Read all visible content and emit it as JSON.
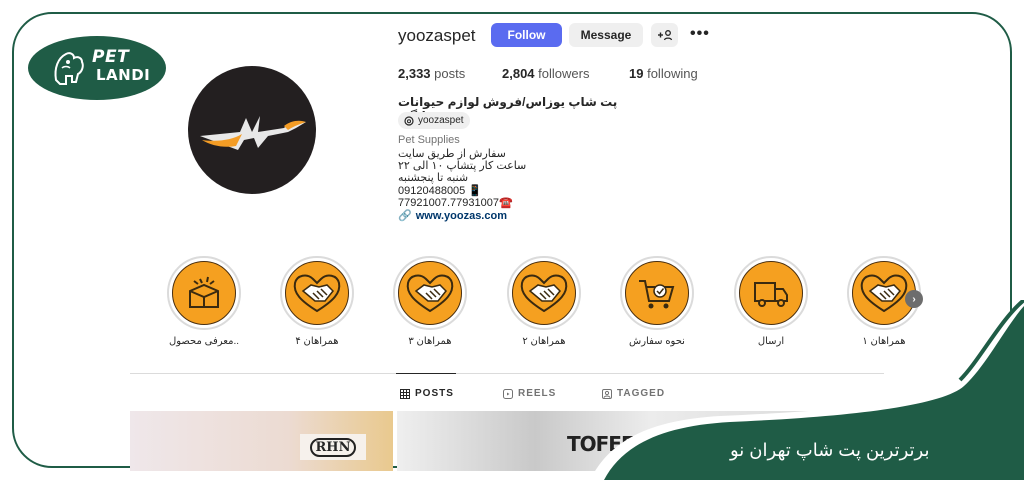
{
  "brand": {
    "logo_line1": "PET",
    "logo_line2": "LANDI"
  },
  "profile": {
    "username": "yoozaspet",
    "follow_label": "Follow",
    "message_label": "Message",
    "add_user_glyph": "+⧉",
    "more_glyph": "•••",
    "stats": {
      "posts_count": "2,333",
      "posts_label": "posts",
      "followers_count": "2,804",
      "followers_label": "followers",
      "following_count": "19",
      "following_label": "following"
    },
    "bio": {
      "name": "پت شاپ یوزاس/فروش لوازم حیوانات خانگی",
      "threads_handle": "yoozaspet",
      "category": "Pet Supplies",
      "lines": [
        "سفارش از طریق سایت",
        "ساعت کار پتشاپ ۱۰ الی ۲۲",
        "شنبه تا پنجشنبه",
        "09120488005 📱",
        "77921007.77931007☎️"
      ],
      "link": "www.yoozas.com"
    }
  },
  "highlights": [
    {
      "label": "معرفی محصول..",
      "icon": "gift-box-icon"
    },
    {
      "label": "همراهان ۴",
      "icon": "handshake-icon"
    },
    {
      "label": "همراهان ۳",
      "icon": "handshake-icon"
    },
    {
      "label": "همراهان ۲",
      "icon": "handshake-icon"
    },
    {
      "label": "نحوه سفارش",
      "icon": "shopping-cart-icon"
    },
    {
      "label": "ارسال",
      "icon": "delivery-truck-icon"
    },
    {
      "label": "همراهان ۱",
      "icon": "handshake-icon"
    }
  ],
  "tabs": [
    {
      "label": "POSTS",
      "icon": "grid-icon",
      "active": true
    },
    {
      "label": "REELS",
      "icon": "reels-icon",
      "active": false
    },
    {
      "label": "TAGGED",
      "icon": "tagged-icon",
      "active": false
    }
  ],
  "posts": {
    "tile1_logo": "RHN",
    "tile2_logo": "TOFEED"
  },
  "ribbon": {
    "text": "برترترین پت شاپ تهران نو"
  },
  "colors": {
    "brand_green": "#1f5c46",
    "follow_blue": "#5a6bf0",
    "highlight_orange": "#f5a020"
  }
}
